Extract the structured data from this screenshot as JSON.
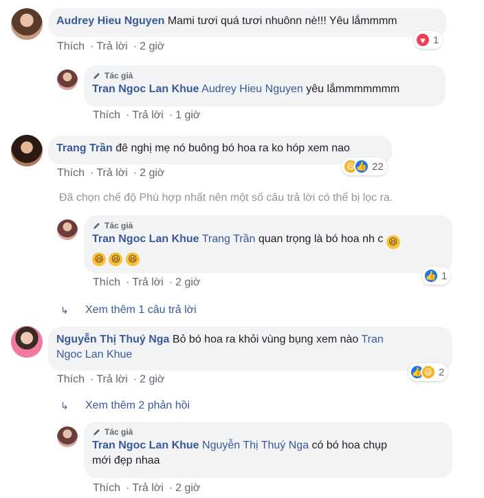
{
  "labels": {
    "like": "Thích",
    "reply": "Trả lời",
    "author": "Tác giả"
  },
  "comments": [
    {
      "name": "Audrey Hieu Nguyen",
      "text": "Mami tươi quá tươi nhuônn nè!!! Yêu lắmmmm",
      "time": "2 giờ",
      "reaction_count": "1",
      "reaction_icons": [
        "heart-icon"
      ]
    },
    {
      "name": "Tran Ngoc Lan Khue",
      "mention": "Audrey Hieu Nguyen",
      "text": "yêu lắmmmmmmm",
      "time": "1 giờ"
    },
    {
      "name": "Trang Trần",
      "text": "đê nghị mẹ nó buông bó hoa ra ko hóp xem nao",
      "time": "2 giờ",
      "reaction_count": "22",
      "reaction_icons": [
        "haha-icon",
        "like-icon"
      ]
    },
    {
      "name": "Tran Ngoc Lan Khue",
      "mention": "Trang Trần",
      "text": "quan trọng là bó hoa nh c",
      "time": "2 giờ",
      "reaction_count": "1",
      "reaction_icons": [
        "like-icon"
      ]
    },
    {
      "name": "Nguyễn Thị Thuý Nga",
      "text": "Bỏ bó hoa ra khỏi vùng bụng xem nào",
      "mention_tail_1": "Tran",
      "mention_tail_2": "Ngoc Lan Khue",
      "time": "2 giờ",
      "reaction_count": "2",
      "reaction_icons": [
        "like-icon",
        "haha-icon"
      ]
    },
    {
      "name": "Tran Ngoc Lan Khue",
      "mention": "Nguyễn Thị Thuý Nga",
      "text_line1": "có bó hoa chụp",
      "text_line2": "mới đẹp nhaa",
      "time": "2 giờ"
    }
  ],
  "filtered_notice": "Đã chọn chế độ Phù hợp nhất nên một số câu trả lời có thể bị lọc ra.",
  "more_replies_1": "Xem thêm 1 câu trả lời",
  "more_replies_2": "Xem thêm 2 phản hồi",
  "colors": {
    "link": "#385898",
    "bubble": "#f2f3f5",
    "meta": "#606770"
  }
}
